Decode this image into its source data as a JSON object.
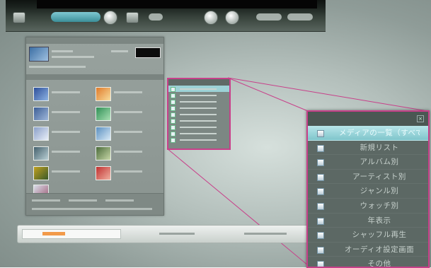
{
  "popup": {
    "menu_items": [
      "メディアの一覧（すべて）",
      "新規リスト",
      "アルバム別",
      "アーティスト別",
      "ジャンル別",
      "ウォッチ別",
      "年表示",
      "シャッフル再生",
      "オーディオ設定画面",
      "その他"
    ]
  },
  "colors": {
    "highlight_border": "#c8408a",
    "selected_row": "#9dd2d6"
  },
  "icons": [
    "media-library-icon",
    "options-icon",
    "close-icon",
    "list-item-icon"
  ]
}
